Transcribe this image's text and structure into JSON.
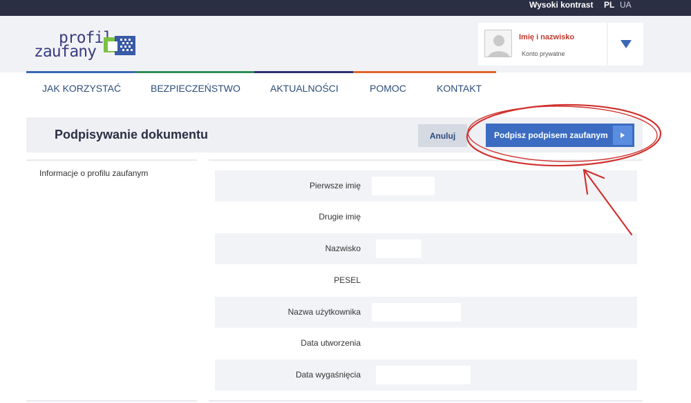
{
  "topbar": {
    "high_contrast": "Wysoki kontrast",
    "lang_pl": "PL",
    "lang_ua": "UA"
  },
  "logo": {
    "line1": "profil",
    "line2": "zaufany"
  },
  "user": {
    "name": "Imię i nazwisko",
    "account_type": "Konto prywatne"
  },
  "nav": {
    "items": [
      "JAK KORZYSTAĆ",
      "BEZPIECZEŃSTWO",
      "AKTUALNOŚCI",
      "POMOC",
      "KONTAKT"
    ]
  },
  "page": {
    "title": "Podpisywanie dokumentu",
    "cancel_label": "Anuluj",
    "sign_label": "Podpisz podpisem zaufanym"
  },
  "sidebar": {
    "item": "Informacje o profilu zaufanym"
  },
  "details": {
    "rows": [
      {
        "label": "Pierwsze imię"
      },
      {
        "label": "Drugie imię"
      },
      {
        "label": "Nazwisko"
      },
      {
        "label": "PESEL"
      },
      {
        "label": "Nazwa użytkownika"
      },
      {
        "label": "Data utworzenia"
      },
      {
        "label": "Data wygaśnięcia"
      }
    ]
  },
  "colors": {
    "topbar": "#2b2f44",
    "primary_button": "#3b6cc1",
    "nav_text": "#2a4d7a",
    "user_name": "#c0392b",
    "annotation": "#d0312d",
    "bar_blue": "#3a66b4",
    "bar_green": "#2e8b57",
    "bar_navy": "#2b2f6e",
    "bar_orange": "#e0632a"
  }
}
